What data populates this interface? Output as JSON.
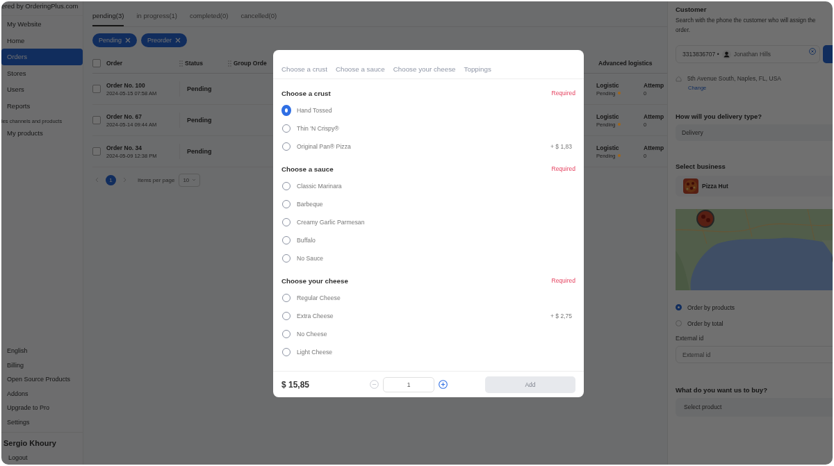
{
  "sidebar": {
    "brand": "ered by OrderingPlus.com",
    "items": [
      {
        "label": "My Website",
        "selected": false
      },
      {
        "label": "Home",
        "selected": false
      },
      {
        "label": "Orders",
        "selected": true
      },
      {
        "label": "Stores",
        "selected": false
      },
      {
        "label": "Users",
        "selected": false
      },
      {
        "label": "Reports",
        "selected": false
      }
    ],
    "section_label": "les channels and products",
    "section_items": [
      {
        "label": "My products",
        "selected": false
      }
    ],
    "bottom_items": [
      "English",
      "Billing",
      "Open Source Products",
      "Addons",
      "Upgrade to Pro",
      "Settings"
    ],
    "user_name": "Sergio Khoury",
    "logout": "Logout"
  },
  "orders": {
    "tabs": [
      {
        "label": "pending(3)",
        "selected": true
      },
      {
        "label": "in progress(1)",
        "selected": false
      },
      {
        "label": "completed(0)",
        "selected": false
      },
      {
        "label": "cancelled(0)",
        "selected": false
      }
    ],
    "filters": [
      "Pending",
      "Preorder"
    ],
    "select_all_checked": false,
    "columns": [
      "Order",
      "Status",
      "Group Orde",
      "Advanced logistics"
    ],
    "rows": [
      {
        "checked": false,
        "order": "Order No. 100",
        "date": "2024-05-15 07:58 AM",
        "status": "Pending",
        "logistic": "Logistic",
        "logistic_status": "Pending",
        "color": "#a0661a",
        "attempts_label": "Attemp",
        "attempts": "0"
      },
      {
        "checked": false,
        "order": "Order No. 67",
        "date": "2024-05-14 09:44 AM",
        "status": "Pending",
        "logistic": "Logistic",
        "logistic_status": "Pending",
        "color": "#a0661a",
        "attempts_label": "Attemp",
        "attempts": "0"
      },
      {
        "checked": false,
        "order": "Order No. 34",
        "date": "2024-05-09 12:38 PM",
        "status": "Pending",
        "logistic": "Logistic",
        "logistic_status": "Pending",
        "color": "#a0661a",
        "attempts_label": "Attemp",
        "attempts": "0"
      }
    ],
    "pagination": {
      "pages": [
        {
          "label": "1",
          "selected": true
        }
      ],
      "items_per_page_label": "Items per page",
      "page_size": "10"
    }
  },
  "customer_panel": {
    "title": "Customer",
    "description": "Search with the phone the customer who will assign the order.",
    "phone": "3313836707 •",
    "customer_name": "Jonathan Hills",
    "address": "5th Avenue South, Naples, FL, USA",
    "change_link": "Change",
    "delivery_label": "How will you delivery type?",
    "delivery_value": "Delivery",
    "business_label": "Select business",
    "business_name": "Pizza Hut",
    "order_modes": [
      {
        "label": "Order by products",
        "selected": true
      },
      {
        "label": "Order by total",
        "selected": false
      }
    ],
    "external_id_label": "External id",
    "external_id_placeholder": "External id",
    "buy_label": "What do you want us to buy?",
    "product_placeholder": "Select product"
  },
  "modal": {
    "tabs": [
      "Choose a crust",
      "Choose a sauce",
      "Choose your cheese",
      "Toppings"
    ],
    "sections": [
      {
        "title": "Choose a crust",
        "badge": "Required",
        "options": [
          {
            "label": "Hand Tossed",
            "selected": true
          },
          {
            "label": "Thin 'N Crispy®",
            "selected": false
          },
          {
            "label": "Original Pan® Pizza",
            "price": "+ $ 1,83",
            "selected": false
          }
        ]
      },
      {
        "title": "Choose a sauce",
        "badge": "Required",
        "options": [
          {
            "label": "Classic Marinara",
            "selected": false
          },
          {
            "label": "Barbeque",
            "selected": false
          },
          {
            "label": "Creamy Garlic Parmesan",
            "selected": false
          },
          {
            "label": "Buffalo",
            "selected": false
          },
          {
            "label": "No Sauce",
            "selected": false
          }
        ]
      },
      {
        "title": "Choose your cheese",
        "badge": "Required",
        "options": [
          {
            "label": "Regular Cheese",
            "selected": false
          },
          {
            "label": "Extra Cheese",
            "price": "+ $ 2,75",
            "selected": false
          },
          {
            "label": "No Cheese",
            "selected": false
          },
          {
            "label": "Light Cheese",
            "selected": false
          }
        ]
      }
    ],
    "footer": {
      "total": "$ 15,85",
      "quantity": "1",
      "decrease_disabled": true,
      "add_button": "Add",
      "add_disabled": true
    }
  }
}
